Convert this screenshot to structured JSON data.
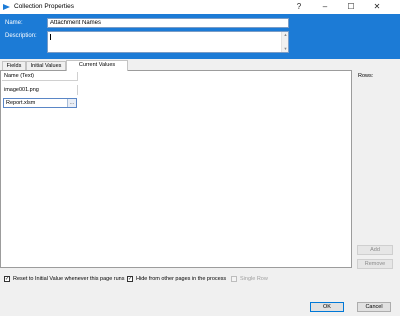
{
  "window": {
    "title": "Collection Properties",
    "controls": {
      "help": "?",
      "minimize": "–",
      "maximize": "☐",
      "close": "✕"
    }
  },
  "form": {
    "name_label": "Name:",
    "name_value": "Attachment Names",
    "description_label": "Description:",
    "description_value": ""
  },
  "tabs": [
    {
      "label": "Fields",
      "active": false
    },
    {
      "label": "Initial Values",
      "active": false
    },
    {
      "label": "Current Values",
      "active": true
    }
  ],
  "grid": {
    "column_header": "Name (Text)",
    "rows": [
      "image001.png"
    ],
    "editing_value": "Report.xlsm",
    "edit_button": "..."
  },
  "side": {
    "rows_label": "Rows:",
    "add_label": "Add",
    "remove_label": "Remove"
  },
  "options": {
    "reset_label": "Reset to Initial Value whenever this page runs",
    "reset_checked": true,
    "hide_label": "Hide from other pages in the process",
    "hide_checked": true,
    "single_row_label": "Single Row",
    "single_row_checked": false
  },
  "footer": {
    "ok_label": "OK",
    "cancel_label": "Cancel"
  },
  "colors": {
    "header_blue": "#1c7bd6",
    "focus_border": "#0078d7"
  }
}
